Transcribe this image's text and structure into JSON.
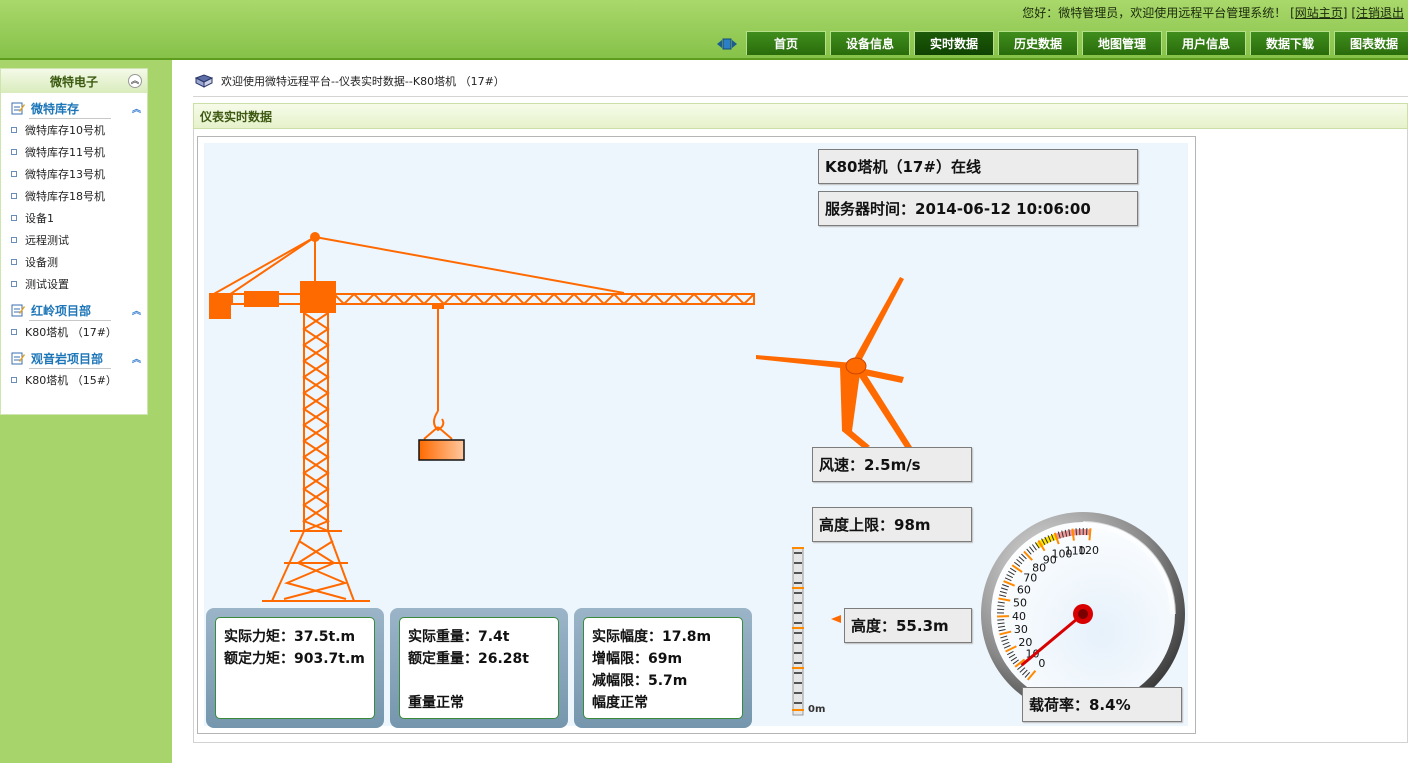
{
  "header": {
    "welcome": "您好：微特管理员，欢迎使用远程平台管理系统！",
    "home_link": "[网站主页]",
    "logout_link": "[注销退出"
  },
  "nav": {
    "tabs": [
      {
        "label": "首页"
      },
      {
        "label": "设备信息"
      },
      {
        "label": "实时数据",
        "active": true
      },
      {
        "label": "历史数据"
      },
      {
        "label": "地图管理"
      },
      {
        "label": "用户信息"
      },
      {
        "label": "数据下载"
      },
      {
        "label": "图表数据"
      }
    ]
  },
  "sidebar": {
    "title": "微特电子",
    "groups": [
      {
        "label": "微特库存",
        "items": [
          "微特库存10号机",
          "微特库存11号机",
          "微特库存13号机",
          "微特库存18号机",
          "设备1",
          "远程测试",
          "设备测",
          "测试设置"
        ]
      },
      {
        "label": "红岭项目部",
        "items": [
          "K80塔机 （17#）"
        ]
      },
      {
        "label": "观音岩项目部",
        "items": [
          "K80塔机 （15#）"
        ]
      }
    ]
  },
  "breadcrumb": "欢迎使用微特远程平台--仪表实时数据--K80塔机 （17#）",
  "panel_title": "仪表实时数据",
  "status": {
    "crane_status": "K80塔机（17#）在线",
    "server_time": "服务器时间：2014-06-12 10:06:00",
    "wind_speed": "风速：2.5m/s",
    "height_limit": "高度上限：98m",
    "height": "高度：55.3m",
    "load_rate": "载荷率：8.4%"
  },
  "cards": {
    "moment": {
      "actual": "实际力矩：37.5t.m",
      "rated": "额定力矩：903.7t.m"
    },
    "weight": {
      "actual": "实际重量：7.4t",
      "rated": "额定重量：26.28t",
      "state": "重量正常"
    },
    "range": {
      "actual": "实际幅度：17.8m",
      "increase_limit": "增幅限：69m",
      "decrease_limit": "减幅限：5.7m",
      "state": "幅度正常"
    }
  },
  "height_scale": {
    "zero_label": "0m",
    "value_fraction": 0.564
  },
  "gauge": {
    "ticks": [
      "0",
      "10",
      "20",
      "30",
      "40",
      "50",
      "60",
      "70",
      "80",
      "90",
      "100",
      "110",
      "120"
    ],
    "value": 8.4,
    "min": 0,
    "max": 120
  },
  "colors": {
    "accent": "#ff6a00",
    "nav_tab": "#2f7912",
    "sidebar_bg": "#a7d56b"
  }
}
